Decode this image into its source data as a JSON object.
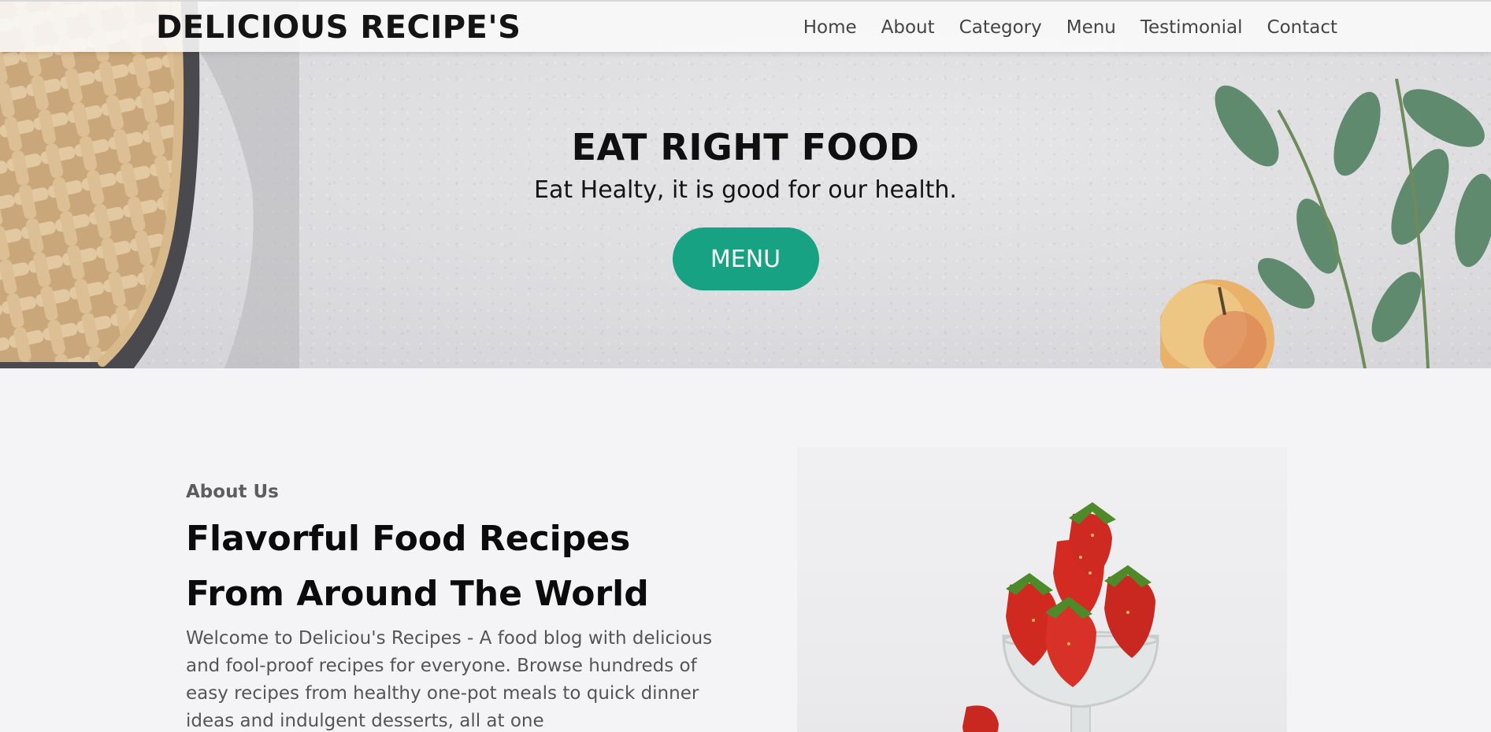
{
  "navbar": {
    "brand": "DELICIOUS RECIPE'S",
    "links": [
      "Home",
      "About",
      "Category",
      "Menu",
      "Testimonial",
      "Contact"
    ]
  },
  "hero": {
    "title": "EAT RIGHT FOOD",
    "subtitle": "Eat Healty, it is good for our health.",
    "button_label": "MENU",
    "button_color": "#17a283"
  },
  "about": {
    "label": "About Us",
    "heading": "Flavorful Food Recipes From Around The World",
    "body": "Welcome to Deliciou's Recipes - A food blog with delicious and fool-proof recipes for everyone. Browse hundreds of easy recipes from healthy one-pot meals to quick dinner ideas and indulgent desserts, all at one"
  }
}
